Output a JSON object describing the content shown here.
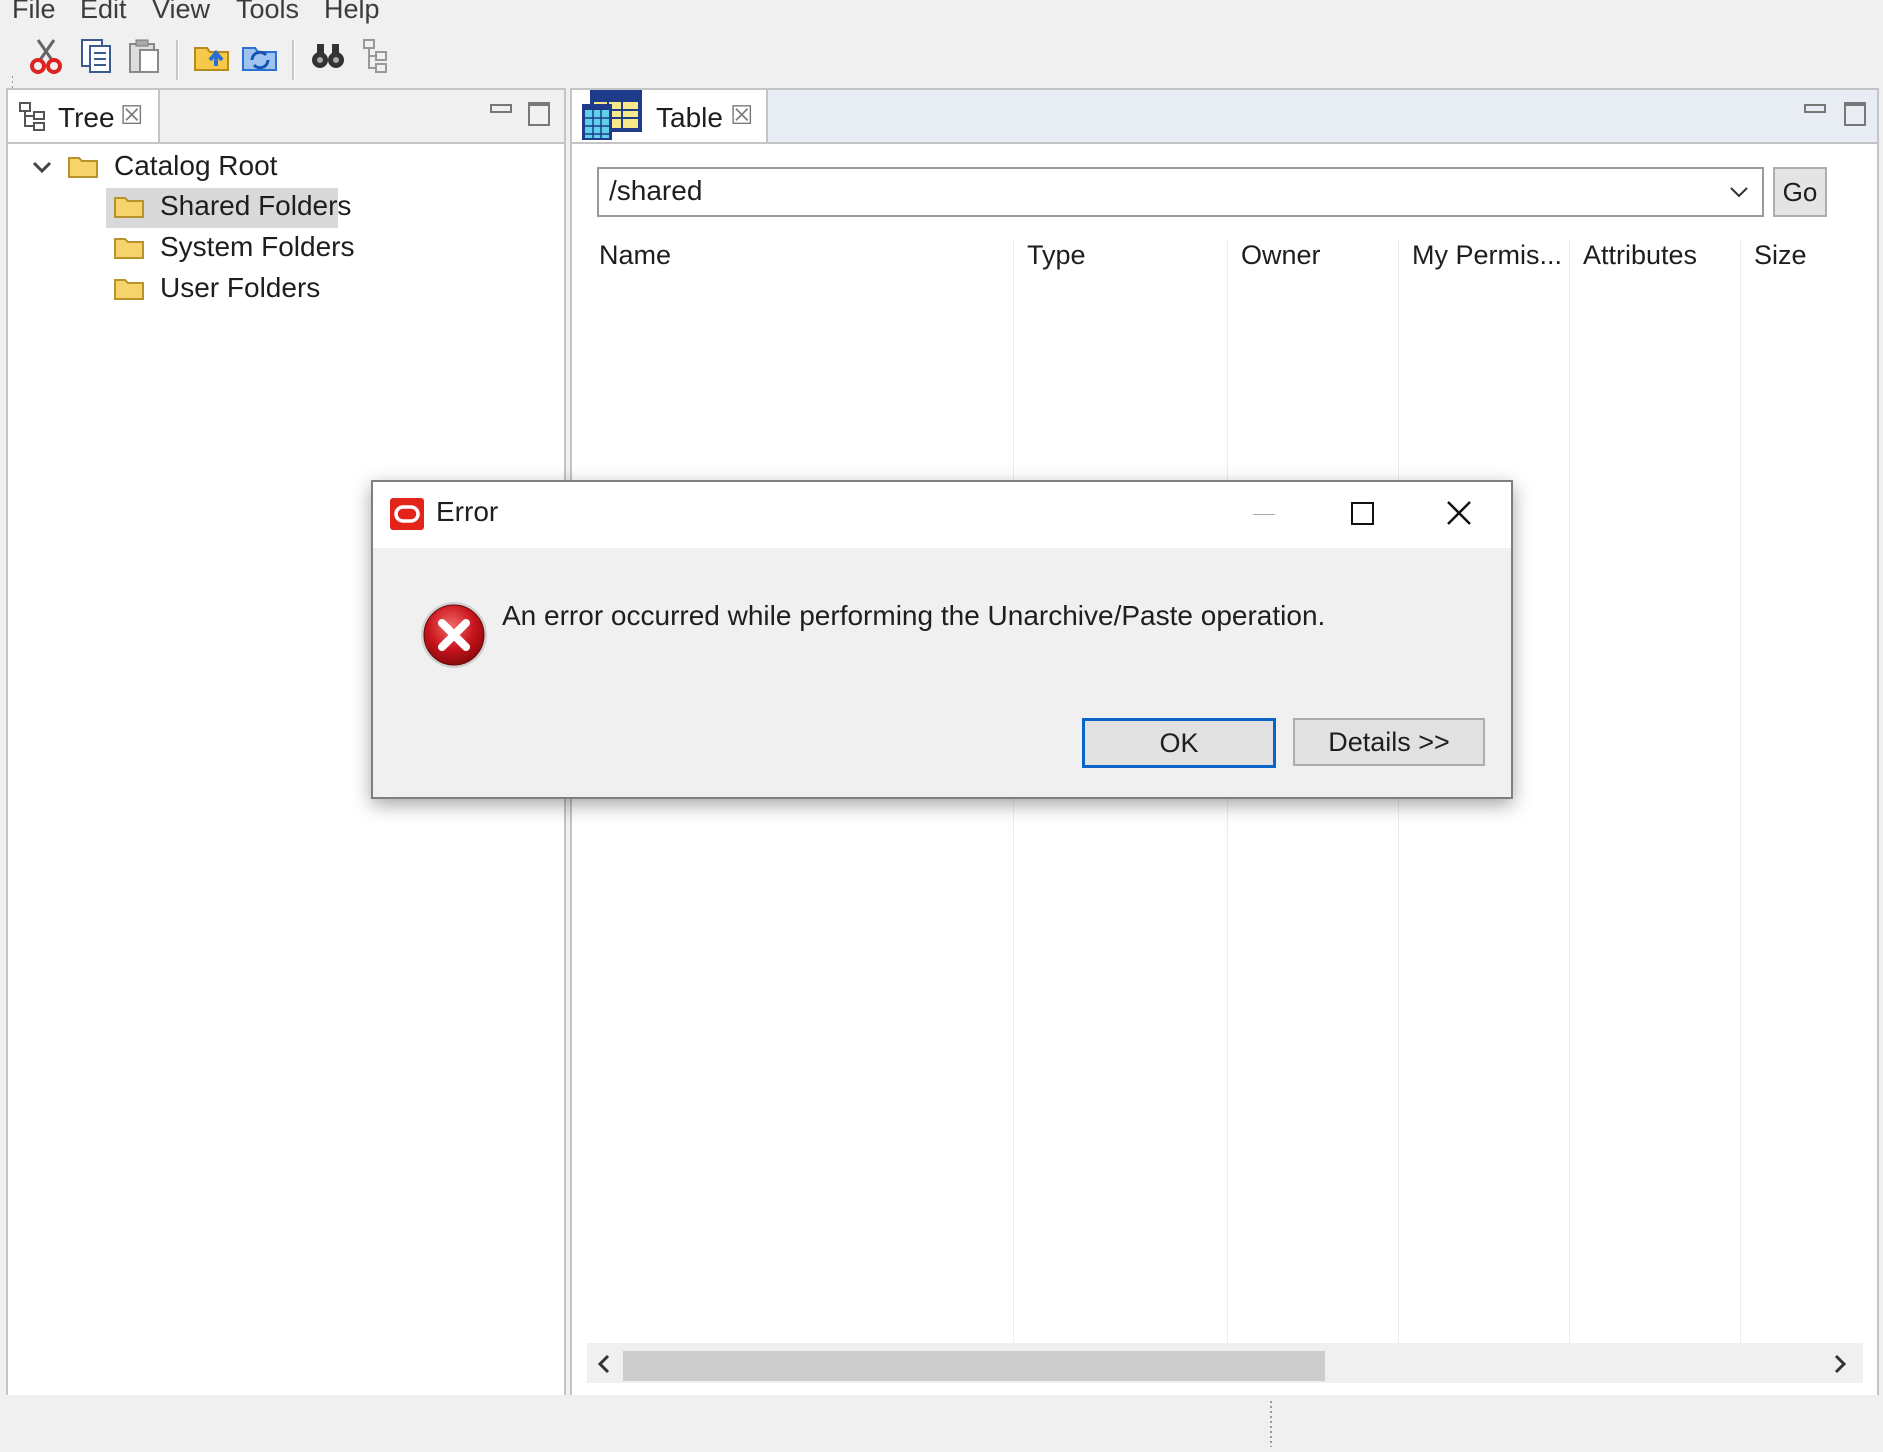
{
  "menu": [
    "File",
    "Edit",
    "View",
    "Tools",
    "Help"
  ],
  "toolbar": {
    "icons": [
      "cut-icon",
      "copy-icon",
      "paste-icon",
      "open-folder-icon",
      "refresh-icon",
      "find-icon",
      "tree-view-icon"
    ]
  },
  "tree_panel": {
    "tab_label": "Tree",
    "close_glyph": "☒",
    "items": [
      {
        "label": "Catalog Root",
        "level": 0,
        "expanded": true
      },
      {
        "label": "Shared Folders",
        "level": 1,
        "selected": true
      },
      {
        "label": "System Folders",
        "level": 1
      },
      {
        "label": "User Folders",
        "level": 1
      }
    ]
  },
  "table_panel": {
    "tab_label": "Table",
    "close_glyph": "☒",
    "path": "/shared",
    "go_label": "Go",
    "columns": [
      "Name",
      "Type",
      "Owner",
      "My Permis...",
      "Attributes",
      "Size"
    ],
    "rows": []
  },
  "dialog": {
    "title": "Error",
    "message": "An error occurred while performing the Unarchive/Paste operation.",
    "ok_label": "OK",
    "details_label": "Details >>",
    "icon": "error-icon",
    "brand_color": "#e3241b"
  },
  "colors": {
    "accent": "#0a64c8",
    "selection": "#d9d9d9",
    "folder": "#f6d36b"
  }
}
